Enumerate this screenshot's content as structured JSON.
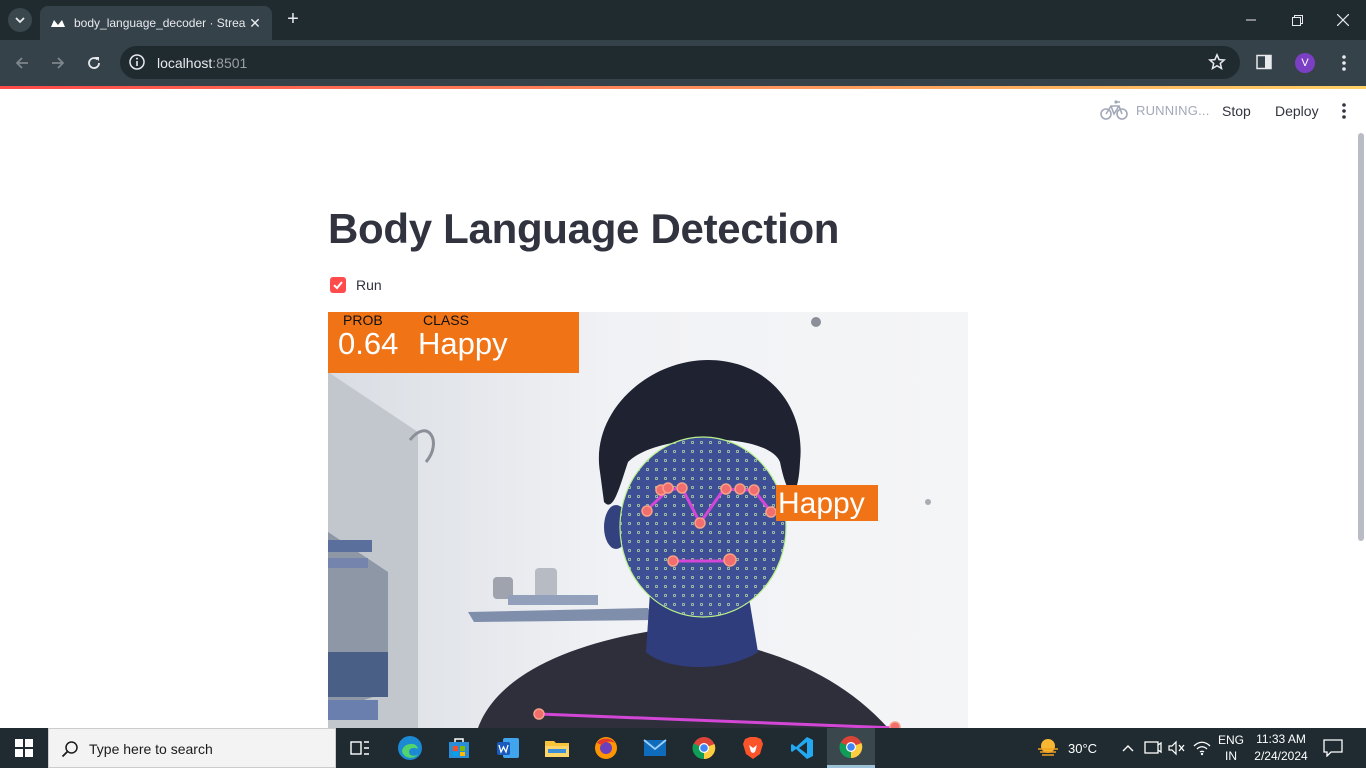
{
  "browser": {
    "tab_title": "body_language_decoder · Streamlit",
    "url_host": "localhost",
    "url_port": ":8501",
    "profile_initial": "V"
  },
  "streamlit": {
    "status": "RUNNING...",
    "stop_label": "Stop",
    "deploy_label": "Deploy"
  },
  "main": {
    "title": "Body Language Detection",
    "run_label": "Run",
    "run_checked": true
  },
  "frame": {
    "prob_label": "PROB",
    "class_label": "CLASS",
    "prob_value": "0.64",
    "class_value": "Happy",
    "face_label": "Happy",
    "accent_color": "#f07316"
  },
  "taskbar": {
    "search_placeholder": "Type here to search",
    "weather": "30°C",
    "lang_line1": "ENG",
    "lang_line2": "IN",
    "time": "11:33 AM",
    "date": "2/24/2024"
  },
  "colors": {
    "streamlit_red": "#ff4b4b",
    "browser_dark": "#202b30",
    "browser_toolbar": "#35424a"
  }
}
